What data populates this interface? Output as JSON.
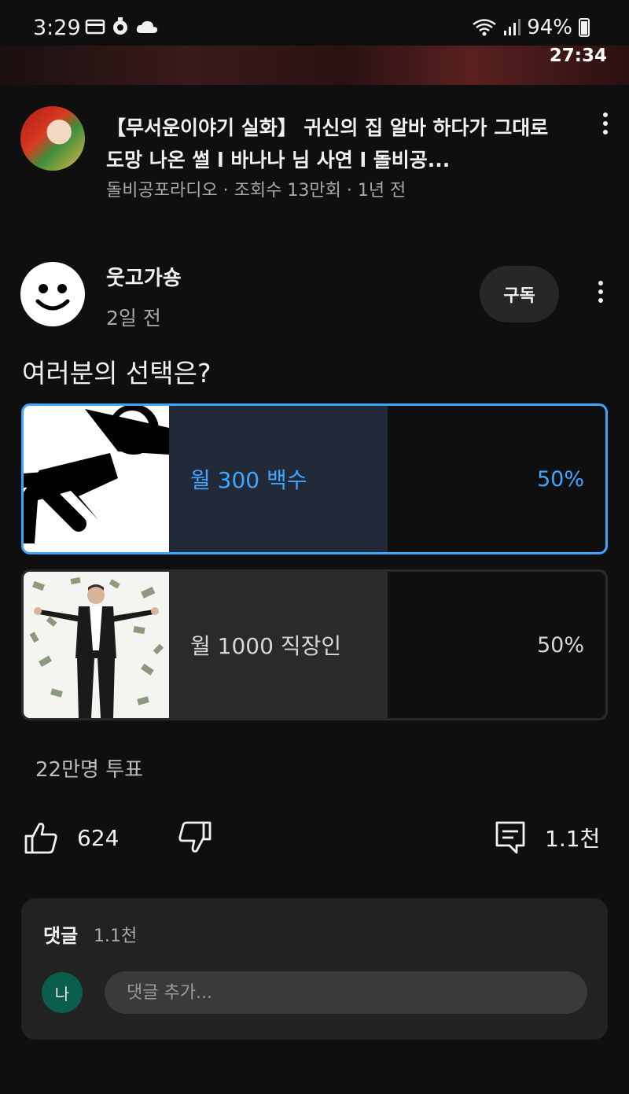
{
  "status_bar": {
    "time": "3:29",
    "battery": "94%"
  },
  "mini_player": {
    "duration": "27:34"
  },
  "video": {
    "title": "【무서운이야기 실화】 귀신의 집 알바 하다가 그대로 도망 나온 썰 l 바나나 님 사연 l 돌비공...",
    "meta": "돌비공포라디오 · 조회수 13만회 · 1년 전"
  },
  "post": {
    "channel": "웃고가숑",
    "time": "2일 전",
    "subscribe_label": "구독",
    "question": "여러분의 선택은?"
  },
  "poll": {
    "options": [
      {
        "label": "월 300 백수",
        "percent": "50%",
        "fill_fraction": 0.5,
        "selected": true
      },
      {
        "label": "월 1000 직장인",
        "percent": "50%",
        "fill_fraction": 0.5,
        "selected": false
      }
    ],
    "votes": "22만명 투표"
  },
  "actions": {
    "likes": "624",
    "comments": "1.1천"
  },
  "comments": {
    "title": "댓글",
    "count": "1.1천",
    "user_initial": "나",
    "placeholder": "댓글 추가..."
  },
  "colors": {
    "background": "#0f0f0f",
    "accent": "#3ea6ff",
    "avatar_green": "#0b5e49"
  }
}
